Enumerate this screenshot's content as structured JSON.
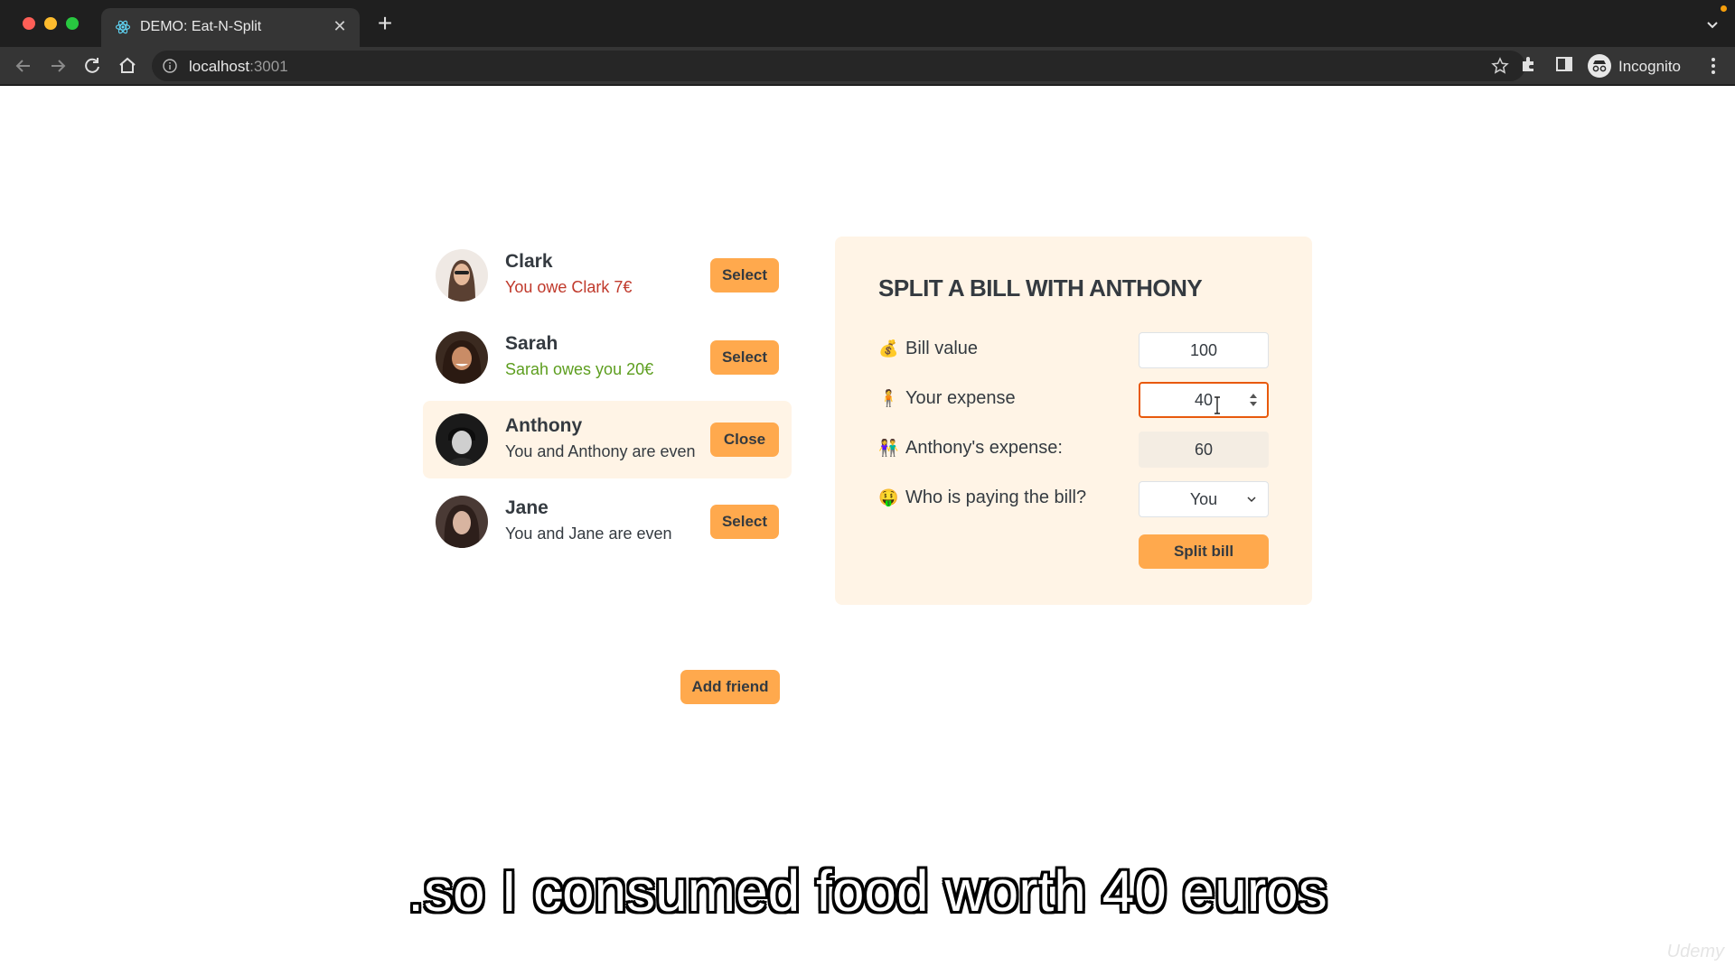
{
  "browser": {
    "tab_title": "DEMO: Eat-N-Split",
    "url_host": "localhost",
    "url_port": ":3001",
    "profile_label": "Incognito"
  },
  "friends": [
    {
      "name": "Clark",
      "status": "You owe Clark 7€",
      "status_type": "owe",
      "button": "Select",
      "selected": false
    },
    {
      "name": "Sarah",
      "status": "Sarah owes you 20€",
      "status_type": "owed",
      "button": "Select",
      "selected": false
    },
    {
      "name": "Anthony",
      "status": "You and Anthony are even",
      "status_type": "even",
      "button": "Close",
      "selected": true
    },
    {
      "name": "Jane",
      "status": "You and Jane are even",
      "status_type": "even",
      "button": "Select",
      "selected": false
    }
  ],
  "add_friend_label": "Add friend",
  "split": {
    "title": "SPLIT A BILL WITH ANTHONY",
    "bill_label": "Bill value",
    "bill_emoji": "💰",
    "bill_value": "100",
    "expense_label": "Your expense",
    "expense_emoji": "🧍",
    "expense_value": "40",
    "friend_expense_label": "Anthony's expense:",
    "friend_expense_emoji": "👫",
    "friend_expense_value": "60",
    "payer_label": "Who is paying the bill?",
    "payer_emoji": "🤑",
    "payer_value": "You",
    "submit_label": "Split bill"
  },
  "subtitle": ".so I consumed food worth 40 euros",
  "watermark": "Udemy",
  "colors": {
    "accent": "#ffa94d",
    "panel": "#fff4e6",
    "owe": "#c0392b",
    "owed": "#5d9e1f",
    "focus": "#e8590c"
  }
}
